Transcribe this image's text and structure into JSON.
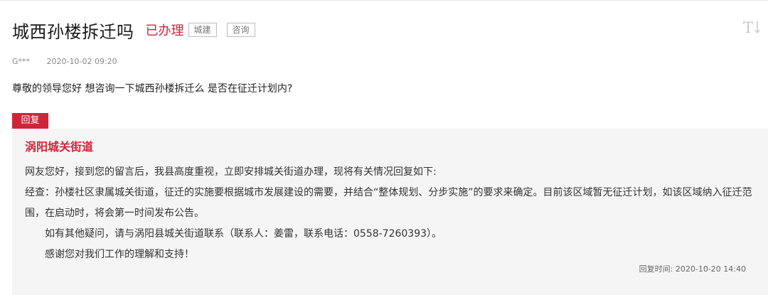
{
  "question": {
    "title": "城西孙楼拆迁吗",
    "status": "已办理",
    "tags": [
      "城建",
      "咨询"
    ],
    "author": "G***",
    "date": "2020-10-02 09:20",
    "content": "尊敬的领导您好 想咨询一下城西孙楼拆迁么 是否在征迁计划内?"
  },
  "reply": {
    "tab_label": "回复",
    "department": "涡阳城关街道",
    "paragraphs": [
      "网友您好，接到您的留言后，我县高度重视，立即安排城关街道办理，现将有关情况回复如下:",
      "经查：孙楼社区隶属城关街道，征迁的实施要根据城市发展建设的需要，并结合“整体规划、分步实施”的要求来确定。目前该区域暂无征迁计划，如该区域纳入征迁范围，在启动时，将会第一时间发布公告。",
      "如有其他疑问，请与涡阳县城关街道联系（联系人：姜雷，联系电话：0558-7260393）。",
      "感谢您对我们工作的理解和支持！"
    ],
    "time_label": "回复时间:",
    "time": "2020-10-20 14:40"
  },
  "icons": {
    "font_toggle": "text-size-icon"
  },
  "colors": {
    "accent": "#d0243a",
    "reply_bg": "#f5f5f5"
  }
}
